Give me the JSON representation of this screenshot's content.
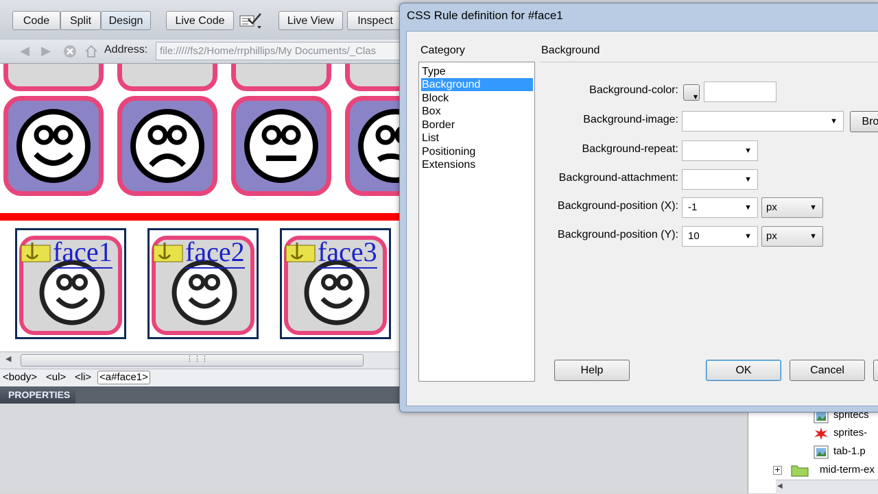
{
  "toolbar": {
    "buttons": [
      "Code",
      "Split",
      "Design",
      "Live Code",
      "Live View",
      "Inspect"
    ]
  },
  "address": {
    "label": "Address:",
    "value": "file://///fs2/Home/rrphillips/My Documents/_Clas"
  },
  "design": {
    "sprites": [
      "face1",
      "face2",
      "face3"
    ]
  },
  "tag_selector": [
    "<body>",
    "<ul>",
    "<li>",
    "<a#face1>"
  ],
  "properties": {
    "tab_label": "PROPERTIES"
  },
  "files": [
    {
      "name": "spritecs",
      "icon": "image-file-icon"
    },
    {
      "name": "sprites-",
      "icon": "fireworks-file-icon"
    },
    {
      "name": "tab-1.p",
      "icon": "image-file-icon"
    },
    {
      "name": "mid-term-ex",
      "icon": "folder-icon"
    }
  ],
  "dialog": {
    "title": "CSS Rule definition for #face1",
    "category_label": "Category",
    "categories": [
      "Type",
      "Background",
      "Block",
      "Box",
      "Border",
      "List",
      "Positioning",
      "Extensions"
    ],
    "selected_category": "Background",
    "section_title": "Background",
    "fields": {
      "color_label": "Background-color:",
      "color_value": "",
      "image_label": "Background-image:",
      "image_value": "",
      "browse_label": "Bro",
      "repeat_label": "Background-repeat:",
      "repeat_value": "",
      "attachment_label": "Background-attachment:",
      "attachment_value": "",
      "posx_label": "Background-position (X):",
      "posx_value": "-1",
      "posx_unit": "px",
      "posy_label": "Background-position (Y):",
      "posy_value": "10",
      "posy_unit": "px"
    },
    "buttons": {
      "help": "Help",
      "ok": "OK",
      "cancel": "Cancel"
    }
  },
  "colors": {
    "tile_border": "#e8457a",
    "tile_fill": "#8a84c6",
    "selection": "#3399ff",
    "divider": "#ff0000"
  }
}
